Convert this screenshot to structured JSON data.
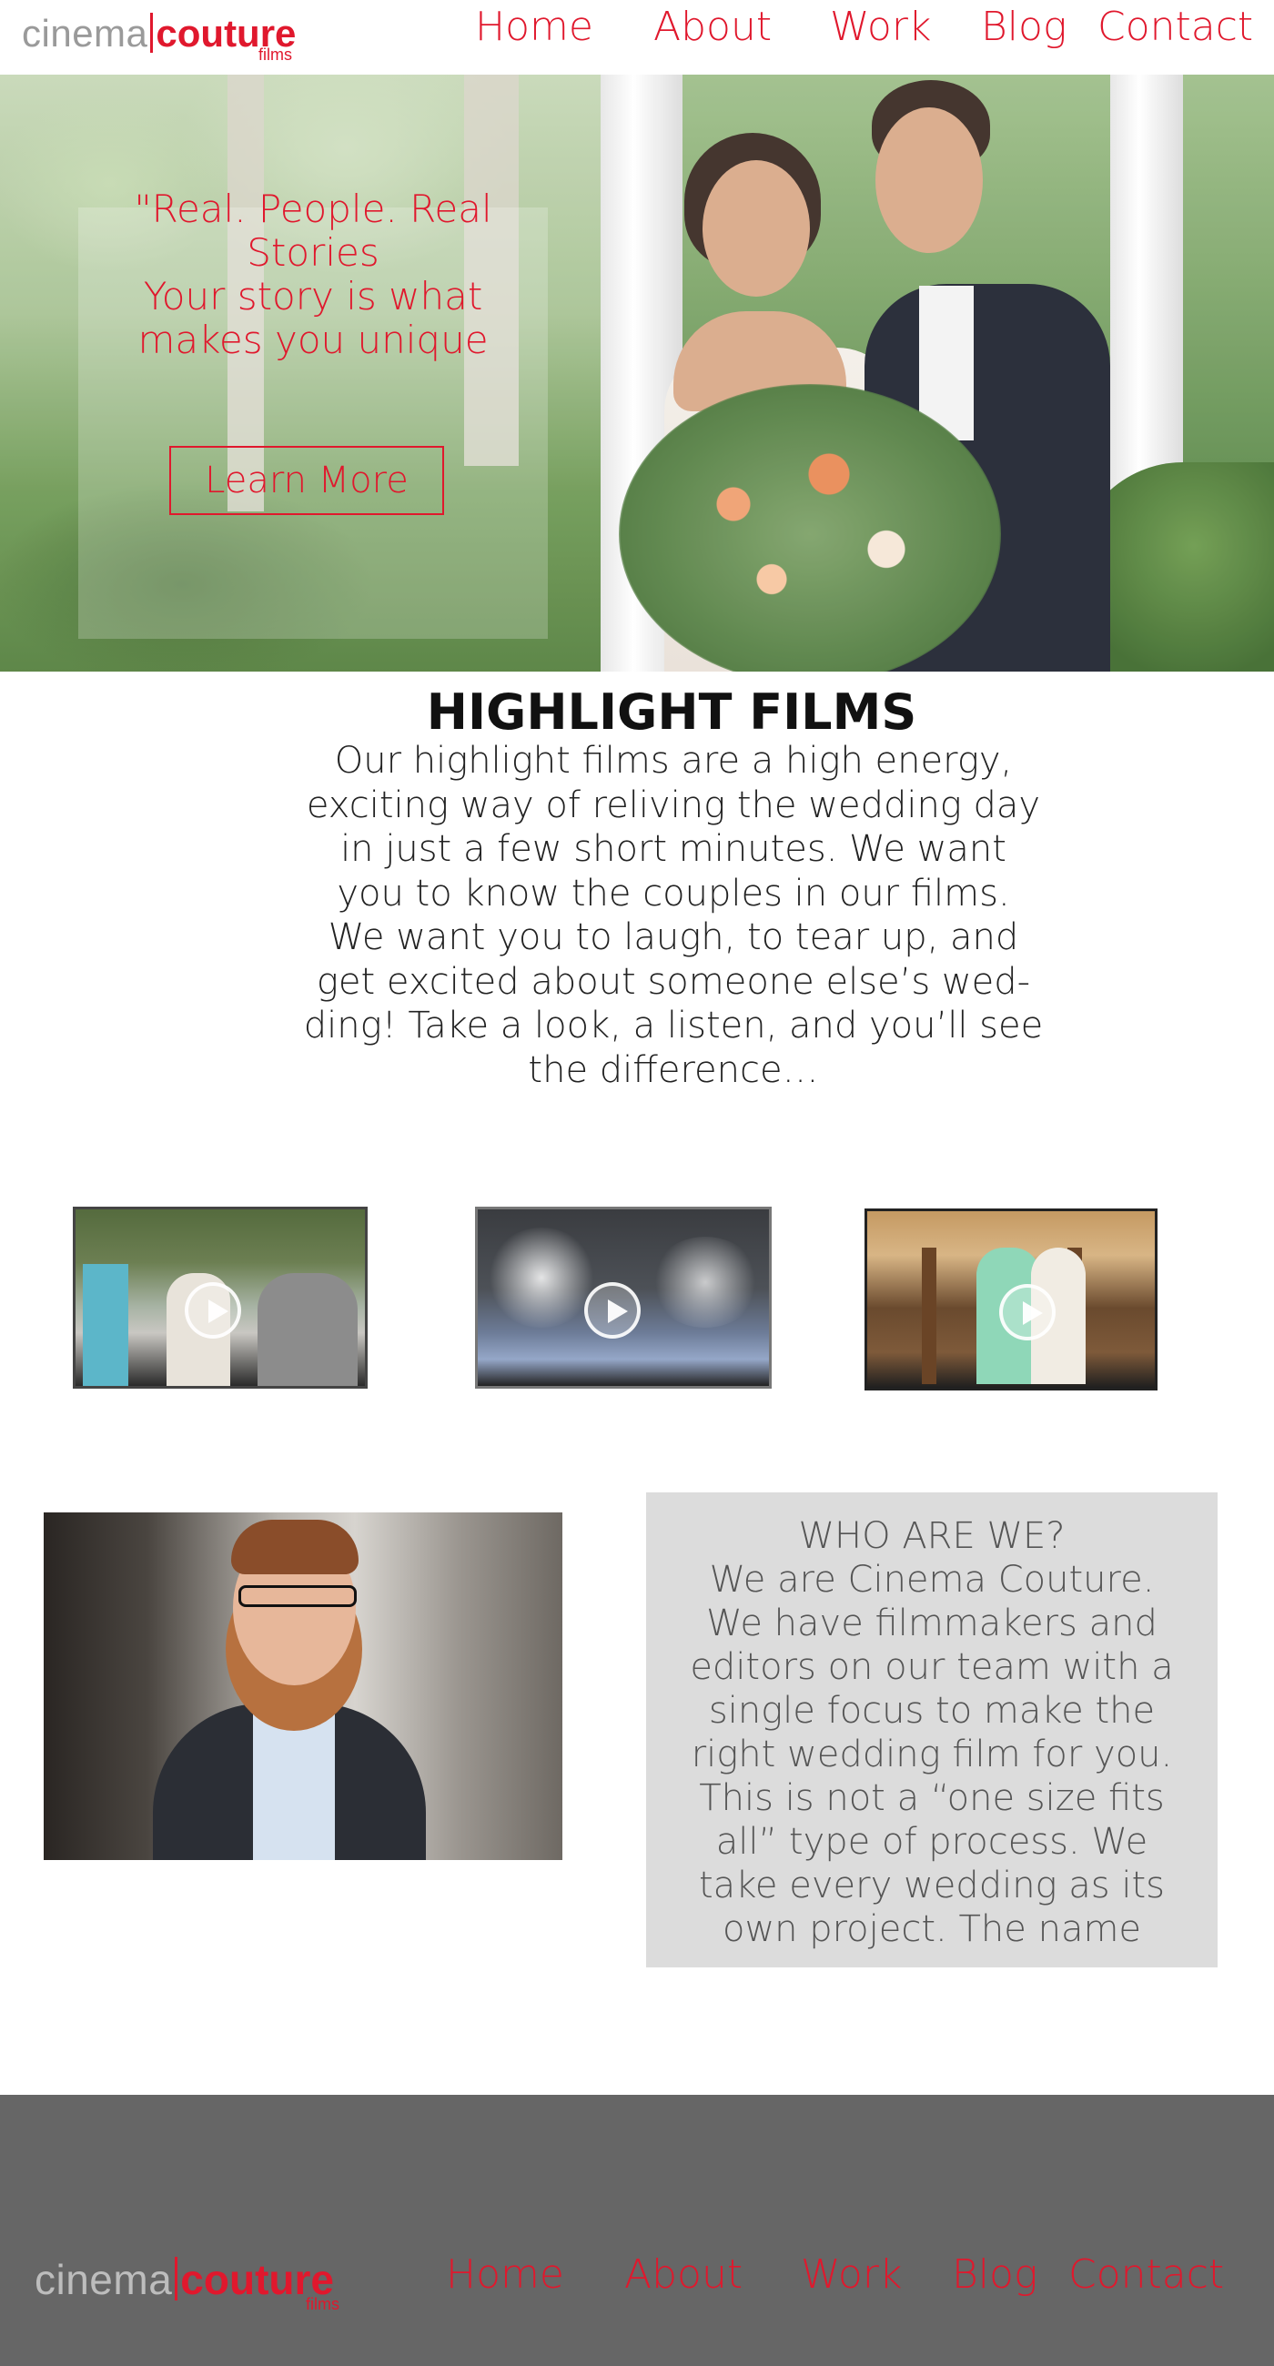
{
  "header": {
    "logo": {
      "cinema": "cinema",
      "couture": "couture",
      "films": "films"
    },
    "nav": [
      "Home",
      "About",
      "Work",
      "Blog",
      "Contact"
    ]
  },
  "hero": {
    "quote_lines": [
      "\"Real. People. Real",
      "Stories",
      "Your story is what",
      "makes you unique"
    ],
    "button_label": "Learn More"
  },
  "highlight": {
    "title": "HIGHLIGHT FILMS",
    "text_lines": [
      "Our highlight films are a high energy,",
      "exciting way of reliving the wedding day",
      "in just a few short minutes. We want",
      "you to know the couples in our films.",
      "We want you to laugh, to tear up, and",
      "get excited about someone else’s wed-",
      "ding! Take a look, a listen, and you’ll see",
      "the difference…"
    ]
  },
  "videos": [
    {
      "icon": "play-icon"
    },
    {
      "icon": "play-icon"
    },
    {
      "icon": "play-icon"
    }
  ],
  "about": {
    "title": "WHO ARE WE?",
    "text_lines": [
      "We are Cinema Couture.",
      "We have filmmakers and",
      "editors on our team with a",
      "single focus to make the",
      "right wedding film for you.",
      "This is not a “one size fits",
      "all” type of process. We",
      "take every wedding as its",
      "own project. The name"
    ]
  },
  "footer": {
    "logo": {
      "cinema": "cinema",
      "couture": "couture",
      "films": "films"
    },
    "nav": [
      "Home",
      "About",
      "Work",
      "Blog",
      "Contact"
    ]
  },
  "colors": {
    "accent": "#e0182d",
    "footer_bg": "#666666",
    "about_bg": "#dcdcdc"
  }
}
